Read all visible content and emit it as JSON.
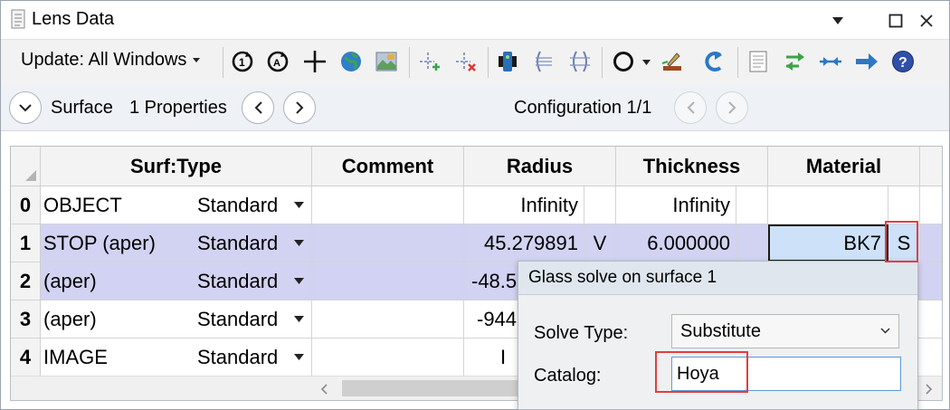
{
  "window": {
    "title": "Lens Data",
    "controls": [
      "menu-dropdown",
      "maximize",
      "close"
    ]
  },
  "toolbar": {
    "update_label": "Update: All Windows",
    "icons": [
      "refresh-icon",
      "auto-refresh-icon",
      "crosshair-icon",
      "globe-icon",
      "map-icon",
      "insert-surface-icon",
      "delete-surface-icon",
      "film-icon",
      "lens-group-icon",
      "lens-align-icon",
      "circle-icon",
      "paint-icon",
      "undo-icon",
      "document-icon",
      "swap-arrows-icon",
      "collapse-arrows-icon",
      "forward-arrow-icon",
      "help-icon"
    ]
  },
  "navbar": {
    "surface_label": "Surface",
    "properties_label": "1 Properties",
    "configuration_label": "Configuration 1/1"
  },
  "grid": {
    "headers": [
      "Surf:Type",
      "Comment",
      "Radius",
      "Thickness",
      "Material"
    ],
    "rows": [
      {
        "num": "0",
        "name": "OBJECT",
        "type": "Standard",
        "comment": "",
        "radius": "Infinity",
        "radius_solve": "",
        "thickness": "Infinity",
        "material": "",
        "material_solve": ""
      },
      {
        "num": "1",
        "name": "STOP (aper)",
        "type": "Standard",
        "comment": "",
        "radius": "45.279891",
        "radius_solve": "V",
        "thickness": "6.000000",
        "material": "BK7",
        "material_solve": "S"
      },
      {
        "num": "2",
        "name": "(aper)",
        "type": "Standard",
        "comment": "",
        "radius": "-48.5",
        "radius_solve": "",
        "thickness": "",
        "material": "",
        "material_solve": ""
      },
      {
        "num": "3",
        "name": "(aper)",
        "type": "Standard",
        "comment": "",
        "radius": "-944",
        "radius_solve": "",
        "thickness": "",
        "material": "",
        "material_solve": ""
      },
      {
        "num": "4",
        "name": "IMAGE",
        "type": "Standard",
        "comment": "",
        "radius": "I",
        "radius_solve": "",
        "thickness": "",
        "material": "",
        "material_solve": ""
      }
    ]
  },
  "popup": {
    "title": "Glass solve on surface 1",
    "solve_type_label": "Solve Type:",
    "solve_type_value": "Substitute",
    "catalog_label": "Catalog:",
    "catalog_value": "Hoya"
  },
  "colors": {
    "selected_row": "#d2d2f2",
    "highlight_box": "#e0403d",
    "material_cell": "#cde1f9"
  }
}
